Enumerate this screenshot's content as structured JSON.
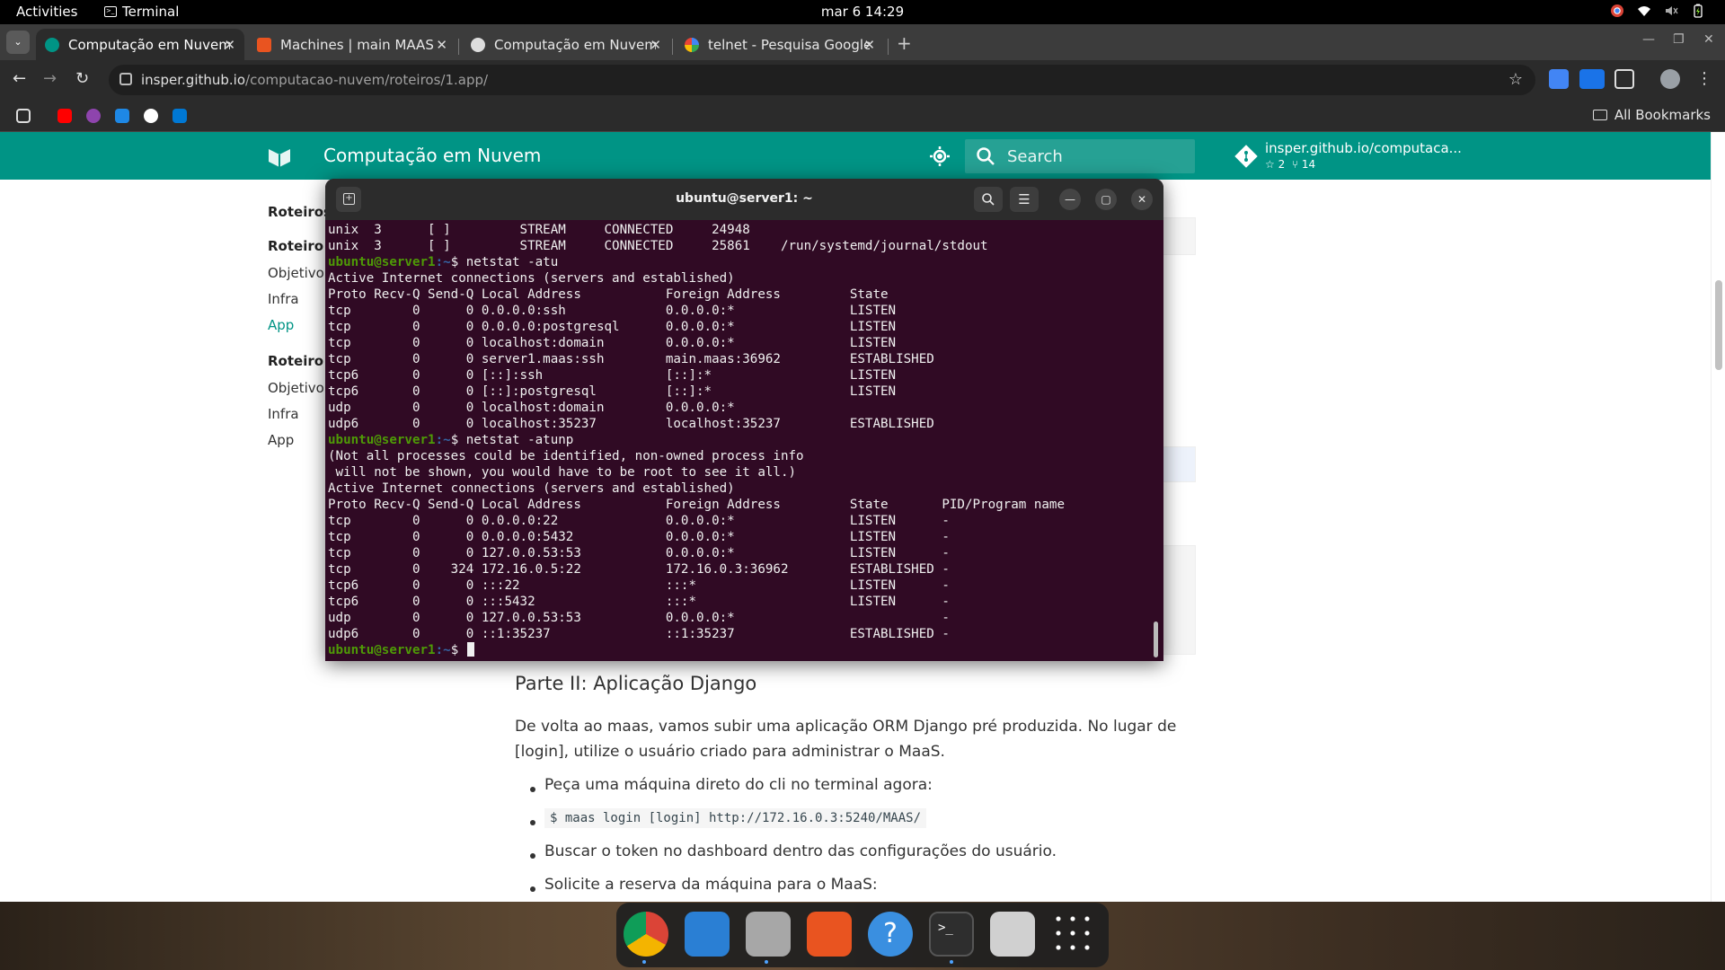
{
  "topbar": {
    "activities": "Activities",
    "app_name": "Terminal",
    "clock": "mar 6  14:29"
  },
  "tabs": [
    {
      "title": "Computação em Nuvem",
      "active": true,
      "favicon_color": "#009485"
    },
    {
      "title": "Machines | main MAAS",
      "active": false,
      "favicon_color": "#e95420"
    },
    {
      "title": "Computação em Nuvem",
      "active": false,
      "favicon_color": "#dddddd"
    },
    {
      "title": "telnet - Pesquisa Google",
      "active": false,
      "favicon_color": "#4285f4"
    }
  ],
  "address_bar": {
    "host": "insper.github.io",
    "path": "/computacao-nuvem/roteiros/1.app/"
  },
  "bookmarks": {
    "all_bookmarks": "All Bookmarks"
  },
  "site": {
    "title": "Computação em Nuvem",
    "search_placeholder": "Search",
    "repo_name": "insper.github.io/computaca...",
    "repo_stars": "2",
    "repo_forks": "14",
    "accent": "#009485"
  },
  "sidebar": {
    "roteiros": "Roteiros",
    "roteiro1": "Roteiro 1",
    "r1_items": [
      "Objetivo",
      "Infra",
      "App"
    ],
    "roteiro2": "Roteiro 2",
    "r2_items": [
      "Objetivo",
      "Infra",
      "App"
    ]
  },
  "content": {
    "heading": "Parte II: Aplicação Django",
    "paragraph": "De volta ao maas, vamos subir uma aplicação ORM Django pré produzida. No lugar de [login], utilize o usuário criado para administrar o MaaS.",
    "bullets": [
      "Peça uma máquina direto do cli no terminal agora:",
      "$ maas login [login] http://172.16.0.3:5240/MAAS/",
      "Buscar o token no dashboard dentro das configurações do usuário.",
      "Solicite a reserva da máquina para o MaaS:"
    ]
  },
  "terminal": {
    "title": "ubuntu@server1: ~",
    "prompt_user": "ubuntu@server1",
    "prompt_path": ":~",
    "lines": [
      {
        "t": "out",
        "text": "unix  3      [ ]         STREAM     CONNECTED     24948"
      },
      {
        "t": "out",
        "text": "unix  3      [ ]         STREAM     CONNECTED     25861    /run/systemd/journal/stdout"
      },
      {
        "t": "cmd",
        "text": "$ netstat -atu"
      },
      {
        "t": "out",
        "text": "Active Internet connections (servers and established)"
      },
      {
        "t": "out",
        "text": "Proto Recv-Q Send-Q Local Address           Foreign Address         State"
      },
      {
        "t": "out",
        "text": "tcp        0      0 0.0.0.0:ssh             0.0.0.0:*               LISTEN"
      },
      {
        "t": "out",
        "text": "tcp        0      0 0.0.0.0:postgresql      0.0.0.0:*               LISTEN"
      },
      {
        "t": "out",
        "text": "tcp        0      0 localhost:domain        0.0.0.0:*               LISTEN"
      },
      {
        "t": "out",
        "text": "tcp        0      0 server1.maas:ssh        main.maas:36962         ESTABLISHED"
      },
      {
        "t": "out",
        "text": "tcp6       0      0 [::]:ssh                [::]:*                  LISTEN"
      },
      {
        "t": "out",
        "text": "tcp6       0      0 [::]:postgresql         [::]:*                  LISTEN"
      },
      {
        "t": "out",
        "text": "udp        0      0 localhost:domain        0.0.0.0:*"
      },
      {
        "t": "out",
        "text": "udp6       0      0 localhost:35237         localhost:35237         ESTABLISHED"
      },
      {
        "t": "cmd",
        "text": "$ netstat -atunp"
      },
      {
        "t": "out",
        "text": "(Not all processes could be identified, non-owned process info"
      },
      {
        "t": "out",
        "text": " will not be shown, you would have to be root to see it all.)"
      },
      {
        "t": "out",
        "text": "Active Internet connections (servers and established)"
      },
      {
        "t": "out",
        "text": "Proto Recv-Q Send-Q Local Address           Foreign Address         State       PID/Program name"
      },
      {
        "t": "out",
        "text": "tcp        0      0 0.0.0.0:22              0.0.0.0:*               LISTEN      -"
      },
      {
        "t": "out",
        "text": "tcp        0      0 0.0.0.0:5432            0.0.0.0:*               LISTEN      -"
      },
      {
        "t": "out",
        "text": "tcp        0      0 127.0.0.53:53           0.0.0.0:*               LISTEN      -"
      },
      {
        "t": "out",
        "text": "tcp        0    324 172.16.0.5:22           172.16.0.3:36962        ESTABLISHED -"
      },
      {
        "t": "out",
        "text": "tcp6       0      0 :::22                   :::*                    LISTEN      -"
      },
      {
        "t": "out",
        "text": "tcp6       0      0 :::5432                 :::*                    LISTEN      -"
      },
      {
        "t": "out",
        "text": "udp        0      0 127.0.0.53:53           0.0.0.0:*                           -"
      },
      {
        "t": "out",
        "text": "udp6       0      0 ::1:35237               ::1:35237               ESTABLISHED -"
      },
      {
        "t": "cmd",
        "text": "$ "
      }
    ]
  },
  "dock": {
    "apps": [
      {
        "name": "chrome",
        "color": "#db4437",
        "running": true
      },
      {
        "name": "vscode",
        "color": "#2a7fd4",
        "running": false
      },
      {
        "name": "files",
        "color": "#a7a7a7",
        "running": true
      },
      {
        "name": "app-center",
        "color": "#e95420",
        "running": false
      },
      {
        "name": "help",
        "color": "#3a8fe0",
        "running": false
      },
      {
        "name": "terminal",
        "color": "#2e2e2e",
        "running": true
      },
      {
        "name": "trash",
        "color": "#d0d0d0",
        "running": false
      },
      {
        "name": "show-apps",
        "color": "#202020",
        "running": false
      }
    ]
  }
}
